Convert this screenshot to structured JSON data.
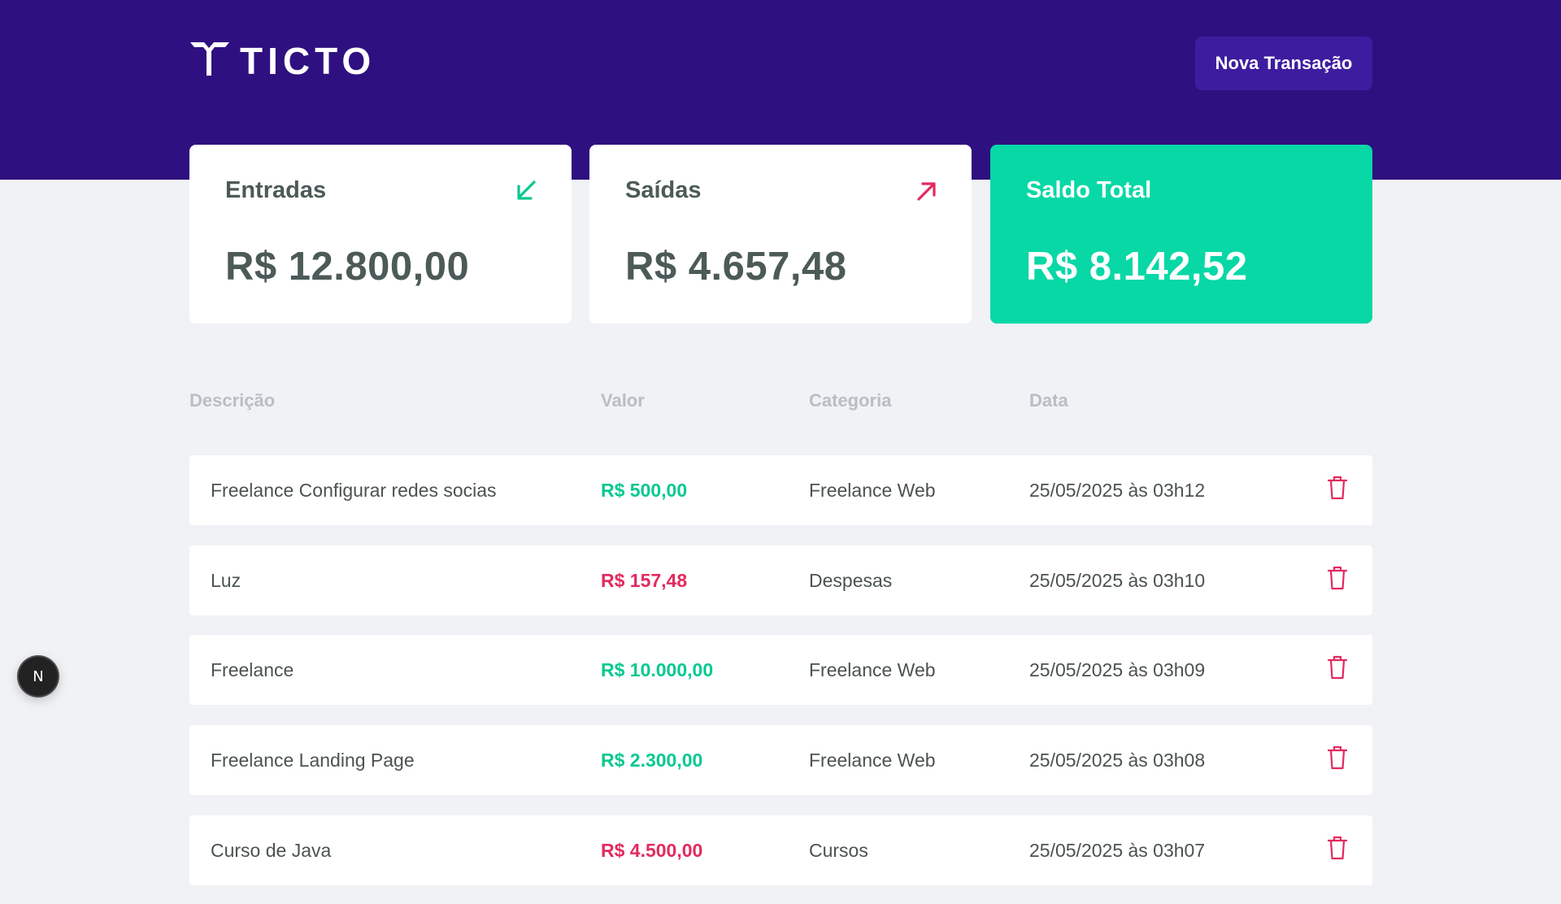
{
  "brand": {
    "name": "TICTO",
    "logo_icon": "ticto-logo-icon"
  },
  "header": {
    "new_transaction_label": "Nova Transação"
  },
  "summary": {
    "income": {
      "title": "Entradas",
      "value": "R$ 12.800,00",
      "icon": "arrow-down-left-icon",
      "icon_color": "#07c98f"
    },
    "outcome": {
      "title": "Saídas",
      "value": "R$ 4.657,48",
      "icon": "arrow-up-right-icon",
      "icon_color": "#e22a5e"
    },
    "total": {
      "title": "Saldo Total",
      "value": "R$ 8.142,52",
      "bg_color": "#07d8a6"
    }
  },
  "table": {
    "headers": {
      "description": "Descrição",
      "value": "Valor",
      "category": "Categoria",
      "date": "Data"
    },
    "rows": [
      {
        "description": "Freelance Configurar redes socias",
        "value": "R$ 500,00",
        "type": "income",
        "category": "Freelance Web",
        "date": "25/05/2025 às 03h12"
      },
      {
        "description": "Luz",
        "value": "R$ 157,48",
        "type": "outcome",
        "category": "Despesas",
        "date": "25/05/2025 às 03h10"
      },
      {
        "description": "Freelance",
        "value": "R$ 10.000,00",
        "type": "income",
        "category": "Freelance Web",
        "date": "25/05/2025 às 03h09"
      },
      {
        "description": "Freelance Landing Page",
        "value": "R$ 2.300,00",
        "type": "income",
        "category": "Freelance Web",
        "date": "25/05/2025 às 03h08"
      },
      {
        "description": "Curso de Java",
        "value": "R$ 4.500,00",
        "type": "outcome",
        "category": "Cursos",
        "date": "25/05/2025 às 03h07"
      }
    ],
    "delete_icon": "trash-icon"
  },
  "dev_badge": {
    "label": "N"
  },
  "colors": {
    "header_bg": "#2f1080",
    "button_bg": "#3e1c9f",
    "income": "#07c98f",
    "outcome": "#e22a5e",
    "page_bg": "#f0f2f5"
  }
}
